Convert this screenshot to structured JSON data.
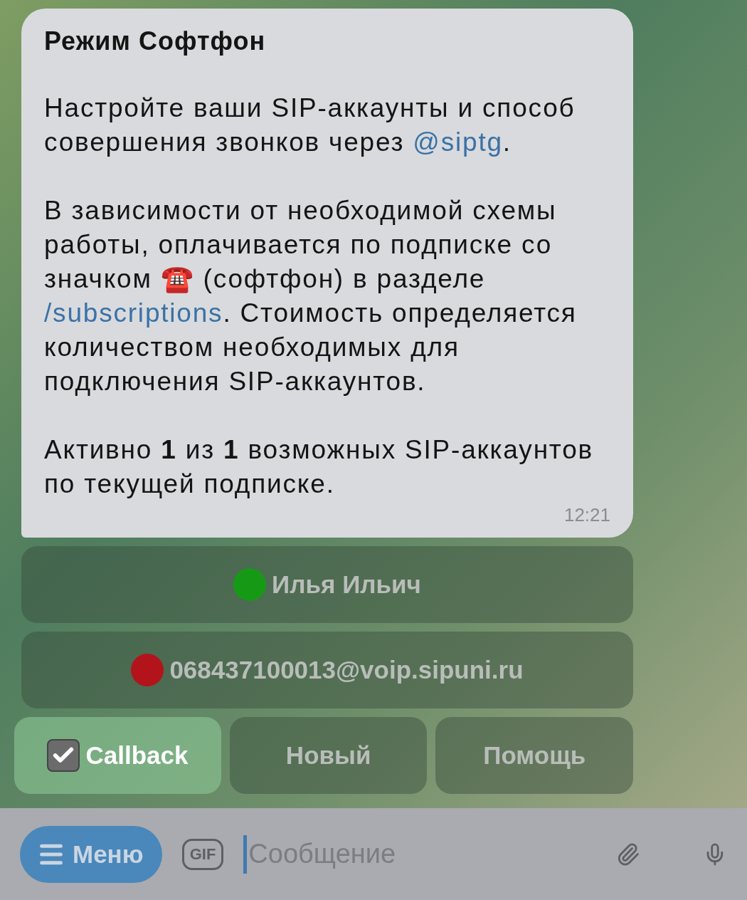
{
  "message": {
    "title": "Режим Софтфон",
    "paragraphs": [
      [
        {
          "kind": "text",
          "text": "Настройте ваши SIP-аккаунты и способ совершения звонков через "
        },
        {
          "kind": "link",
          "text": "@siptg"
        },
        {
          "kind": "text",
          "text": "."
        }
      ],
      [
        {
          "kind": "text",
          "text": "В зависимости от необходимой схемы работы, оплачивается по подписке со значком ☎️ (софтфон) в разделе "
        },
        {
          "kind": "link",
          "text": "/subscriptions"
        },
        {
          "kind": "text",
          "text": ". Стоимость определяется количеством необходимых для подключения SIP-аккаунтов."
        }
      ],
      [
        {
          "kind": "text",
          "text": "Активно **1** из **1** возможных SIP-аккаунтов по текущей подписке."
        }
      ]
    ],
    "time": "12:21"
  },
  "keyboard": [
    [
      {
        "kind": "status",
        "label": "Илья Ильич",
        "color": "#169a16",
        "selected": false
      }
    ],
    [
      {
        "kind": "status",
        "label": "068437100013@voip.sipuni.ru",
        "color": "#b3141c",
        "selected": false
      }
    ],
    [
      {
        "kind": "check",
        "label": "Callback",
        "checked": true,
        "selected": true
      },
      {
        "kind": "plain",
        "label": "Новый",
        "selected": false
      },
      {
        "kind": "plain",
        "label": "Помощь",
        "selected": false
      }
    ]
  ],
  "input_bar": {
    "menu_label": "Меню",
    "gif_label": "GIF",
    "placeholder": "Сообщение"
  }
}
